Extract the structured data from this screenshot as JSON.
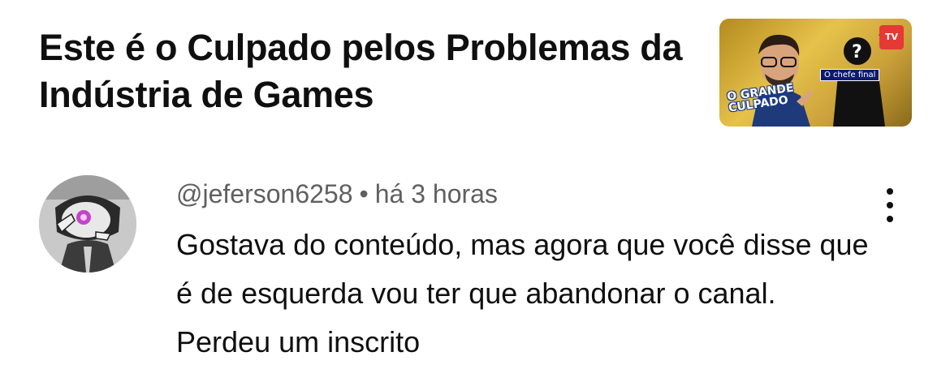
{
  "video": {
    "title": "Este é o Culpado pelos Problemas da Indústria de Games",
    "thumbnail": {
      "channel_badge": "TV",
      "tag": "O chefe final",
      "caption_line1": "O GRANDE",
      "caption_line2": "CULPADO"
    }
  },
  "comment": {
    "author": "@jeferson6258",
    "separator": "•",
    "time": "há 3 horas",
    "text": "Gostava do conteúdo, mas agora que você disse que é de esquerda vou ter que abandonar o canal. Perdeu um inscrito"
  },
  "icons": {
    "more": "more-vertical-icon",
    "avatar": "user-avatar"
  },
  "colors": {
    "text": "#0f0f0f",
    "secondary": "#606060",
    "background": "#ffffff"
  }
}
